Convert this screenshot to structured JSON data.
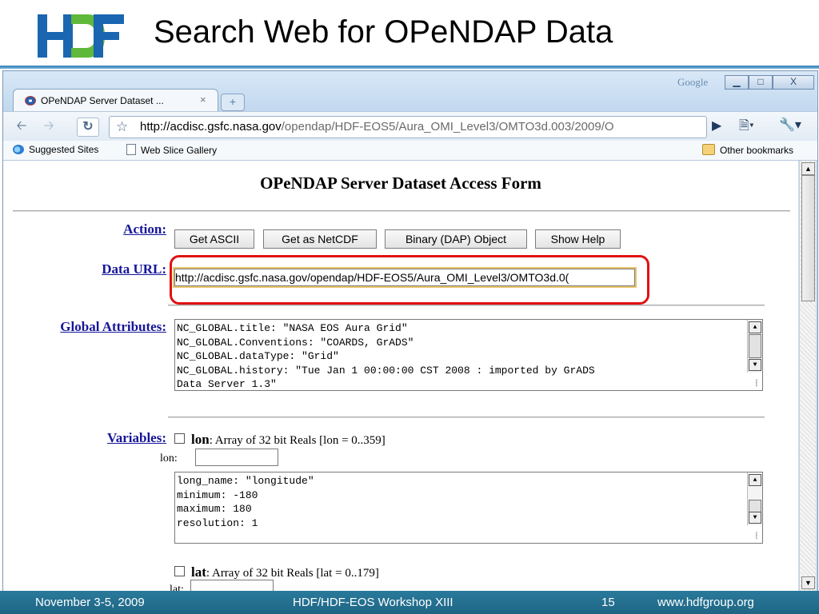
{
  "slide": {
    "title": "Search Web for OPeNDAP Data",
    "logo_alt": "HDF",
    "colors": {
      "logo_blue": "#1a66b0",
      "logo_green": "#5fb83a",
      "footer": "#246f90",
      "highlight": "#e01212"
    }
  },
  "browser": {
    "tab_title": "OPeNDAP Server Dataset ...",
    "tab_close": "×",
    "new_tab": "+",
    "google_label": "Google",
    "window_buttons": {
      "minimize": "▁",
      "maximize": "□",
      "close": "X"
    },
    "url_host": "http://acdisc.gsfc.nasa.gov",
    "url_path": "/opendap/HDF-EOS5/Aura_OMI_Level3/OMTO3d.003/2009/O",
    "bookmarks": {
      "suggested": "Suggested Sites",
      "web_slice": "Web Slice Gallery",
      "other": "Other bookmarks"
    },
    "icons": [
      "back-arrow-icon",
      "forward-arrow-icon",
      "reload-icon",
      "star-icon",
      "go-icon",
      "page-menu-icon",
      "wrench-icon"
    ]
  },
  "form": {
    "title": "OPeNDAP Server Dataset Access Form",
    "action_label": "Action:",
    "buttons": [
      "Get ASCII",
      "Get as NetCDF",
      "Binary (DAP) Object",
      "Show Help"
    ],
    "data_url_label": "Data URL:",
    "data_url_value": "http://acdisc.gsfc.nasa.gov/opendap/HDF-EOS5/Aura_OMI_Level3/OMTO3d.0(",
    "global_label": "Global Attributes:",
    "global_text": "NC_GLOBAL.title: \"NASA EOS Aura Grid\"\nNC_GLOBAL.Conventions: \"COARDS, GrADS\"\nNC_GLOBAL.dataType: \"Grid\"\nNC_GLOBAL.history: \"Tue Jan 1 00:00:00 CST 2008 : imported by GrADS\nData Server 1.3\"",
    "variables_label": "Variables:",
    "lon": {
      "name": "lon",
      "desc": ": Array of 32 bit Reals [lon = 0..359]",
      "input_label": "lon:",
      "attrs": "long_name: \"longitude\"\nminimum: -180\nmaximum: 180\nresolution: 1"
    },
    "lat": {
      "name": "lat",
      "desc": ": Array of 32 bit Reals [lat = 0..179]",
      "input_label": "lat:"
    }
  },
  "footer": {
    "date": "November 3-5, 2009",
    "event": "HDF/HDF-EOS Workshop XIII",
    "page": "15",
    "site": "www.hdfgroup.org"
  }
}
